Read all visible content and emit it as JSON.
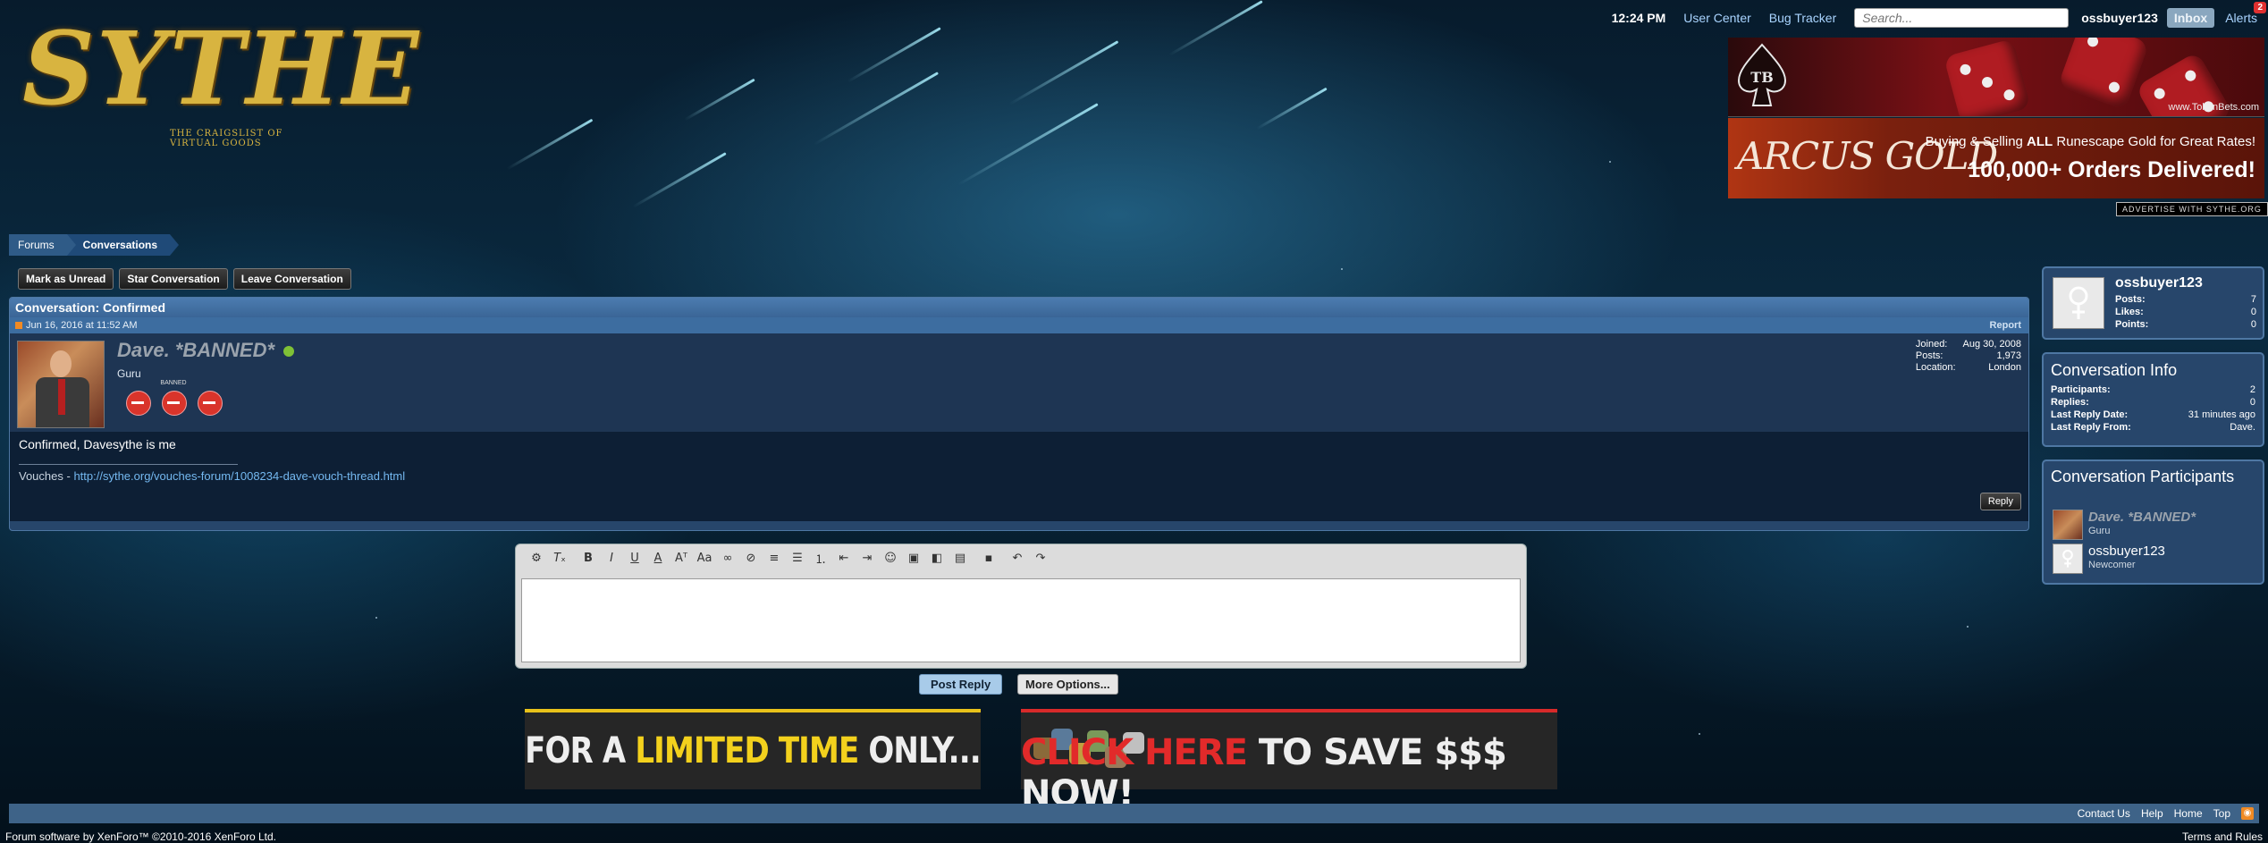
{
  "topnav": {
    "time": "12:24 PM",
    "user_center": "User Center",
    "bug_tracker": "Bug Tracker",
    "search_placeholder": "Search...",
    "username": "ossbuyer123",
    "inbox": "Inbox",
    "alerts": "Alerts",
    "alerts_count": "2"
  },
  "logo": {
    "title": "SYTHE",
    "tagline": "THE CRAIGSLIST OF VIRTUAL GOODS"
  },
  "ads": {
    "tokenbets_logo": "TB",
    "tokenbets_url": "www.TokenBets.com",
    "arcus_brand": "ARCUS GOLD",
    "arcus_line1_pre": "Buying & Selling ",
    "arcus_line1_bold": "ALL",
    "arcus_line1_post": " Runescape Gold for Great Rates!",
    "arcus_line2": "100,000+ Orders Delivered!",
    "advertise": "ADVERTISE WITH SYTHE.ORG",
    "bottom_left_pre": "FOR A ",
    "bottom_left_hl": "LIMITED TIME",
    "bottom_left_post": " ONLY...",
    "bottom_right_hl": "CLICK HERE",
    "bottom_right_post": " TO SAVE $$$ NOW!"
  },
  "breadcrumb": {
    "forums": "Forums",
    "conversations": "Conversations"
  },
  "actions": {
    "mark_unread": "Mark as Unread",
    "star": "Star Conversation",
    "leave": "Leave Conversation"
  },
  "conversation": {
    "title": "Conversation: Confirmed",
    "date": "Jun 16, 2016 at 11:52 AM",
    "report": "Report",
    "poster": {
      "name": "Dave. *BANNED*",
      "title": "Guru",
      "badge_label": "BANNED",
      "joined_label": "Joined:",
      "joined": "Aug 30, 2008",
      "posts_label": "Posts:",
      "posts": "1,973",
      "location_label": "Location:",
      "location": "London"
    },
    "message": "Confirmed, Davesythe is me",
    "signature_prefix": "Vouches - ",
    "signature_link": "http://sythe.org/vouches-forum/1008234-dave-vouch-thread.html",
    "reply": "Reply"
  },
  "editor": {
    "post_reply": "Post Reply",
    "more_options": "More Options..."
  },
  "sidebar": {
    "user": {
      "name": "ossbuyer123",
      "posts_label": "Posts:",
      "posts": "7",
      "likes_label": "Likes:",
      "likes": "0",
      "points_label": "Points:",
      "points": "0"
    },
    "info": {
      "heading": "Conversation Info",
      "participants_label": "Participants:",
      "participants": "2",
      "replies_label": "Replies:",
      "replies": "0",
      "last_reply_date_label": "Last Reply Date:",
      "last_reply_date": "31 minutes ago",
      "last_reply_from_label": "Last Reply From:",
      "last_reply_from": "Dave."
    },
    "participants": {
      "heading": "Conversation Participants",
      "list": [
        {
          "name": "Dave. *BANNED*",
          "role": "Guru"
        },
        {
          "name": "ossbuyer123",
          "role": "Newcomer"
        }
      ]
    }
  },
  "footer": {
    "contact": "Contact Us",
    "help": "Help",
    "home": "Home",
    "top": "Top",
    "copyright": "Forum software by XenForo™ ©2010-2016 XenForo Ltd.",
    "terms": "Terms and Rules"
  }
}
